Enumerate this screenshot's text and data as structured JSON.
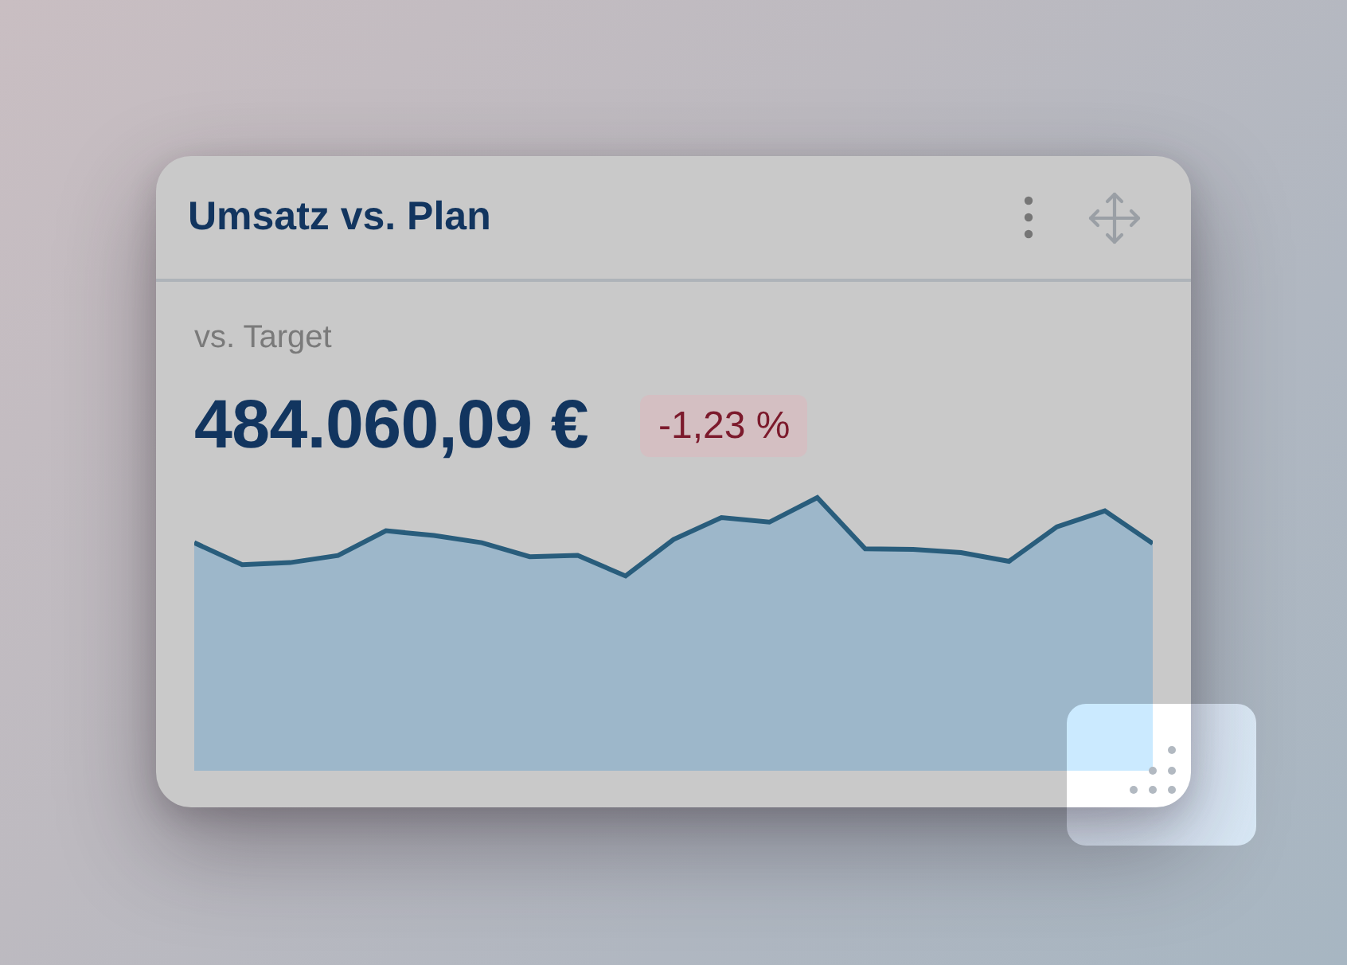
{
  "card": {
    "title": "Umsatz vs. Plan",
    "subtitle": "vs. Target",
    "value": "484.060,09 €",
    "change": {
      "label": "-1,23 %",
      "negative": true
    }
  }
}
